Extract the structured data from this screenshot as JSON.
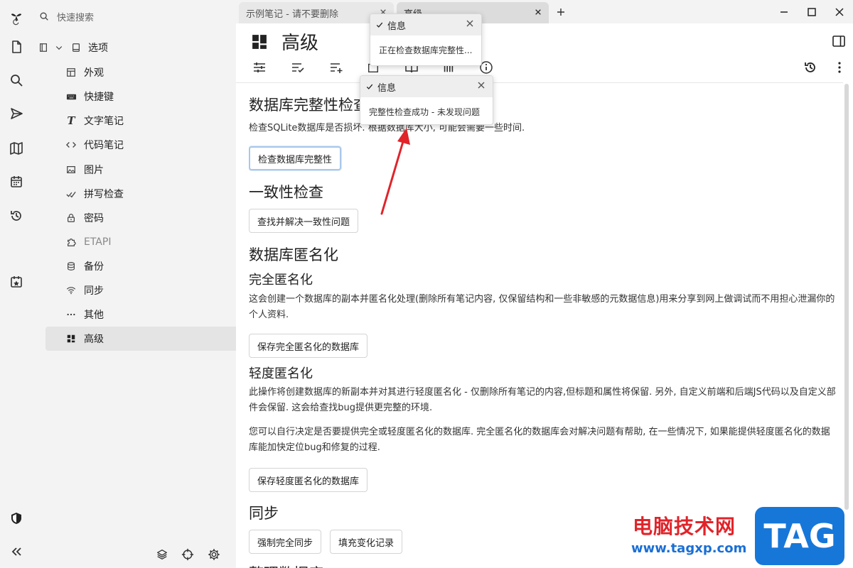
{
  "sidebar": {
    "search_placeholder": "快速搜索",
    "options_label": "选项",
    "items": [
      {
        "label": "外观",
        "icon": "layout-icon"
      },
      {
        "label": "快捷键",
        "icon": "keyboard-icon"
      },
      {
        "label": "文字笔记",
        "icon": "text-icon"
      },
      {
        "label": "代码笔记",
        "icon": "code-icon"
      },
      {
        "label": "图片",
        "icon": "image-icon"
      },
      {
        "label": "拼写检查",
        "icon": "spellcheck-icon"
      },
      {
        "label": "密码",
        "icon": "lock-icon"
      },
      {
        "label": "ETAPI",
        "icon": "puzzle-icon"
      },
      {
        "label": "备份",
        "icon": "database-icon"
      },
      {
        "label": "同步",
        "icon": "wifi-icon"
      },
      {
        "label": "其他",
        "icon": "more-icon"
      },
      {
        "label": "高级",
        "icon": "dashboard-icon"
      }
    ]
  },
  "tabs": [
    {
      "label": "示例笔记 - 请不要删除"
    },
    {
      "label": "高级"
    }
  ],
  "note": {
    "title": "高级"
  },
  "content": {
    "integrity_heading": "数据库完整性检查",
    "integrity_desc": "检查SQLite数据库是否损坏. 根据数据库大小, 可能会需要一些时间.",
    "integrity_button": "检查数据库完整性",
    "consistency_heading": "一致性检查",
    "consistency_button": "查找并解决一致性问题",
    "anon_heading": "数据库匿名化",
    "full_anon_heading": "完全匿名化",
    "full_anon_desc": "这会创建一个数据库的副本并匿名化处理(删除所有笔记内容, 仅保留结构和一些非敏感的元数据信息)用来分享到网上做调试而不用担心泄漏你的个人资料.",
    "full_anon_button": "保存完全匿名化的数据库",
    "light_anon_heading": "轻度匿名化",
    "light_anon_desc": "此操作将创建数据库的新副本并对其进行轻度匿名化 - 仅删除所有笔记的内容,但标题和属性将保留. 另外, 自定义前端和后端JS代码以及自定义部件会保留. 这会给查找bug提供更完整的环境.",
    "anon_choice_desc": "您可以自行决定是否要提供完全或轻度匿名化的数据库. 完全匿名化的数据库会对解决问题有帮助, 在一些情况下, 如果能提供轻度匿名化的数据库能加快定位bug和修复的过程.",
    "light_anon_button": "保存轻度匿名化的数据库",
    "sync_heading": "同步",
    "force_sync_button": "强制完全同步",
    "fill_changes_button": "填充变化记录",
    "cutoff_heading": "整理数据库"
  },
  "toasts": [
    {
      "title": "信息",
      "message": "正在检查数据库完整性..."
    },
    {
      "title": "信息",
      "message": "完整性检查成功 - 未发现问题"
    }
  ],
  "watermark": {
    "site_name": "电脑技术网",
    "url": "www.tagxp.com",
    "logo_text": "TAG"
  },
  "colors": {
    "sidebar_bg": "#f3f3f3",
    "active_item_bg": "#e4e4e4",
    "arrow": "#e0242a",
    "watermark_red": "#e0242a",
    "watermark_blue": "#1677d9"
  }
}
